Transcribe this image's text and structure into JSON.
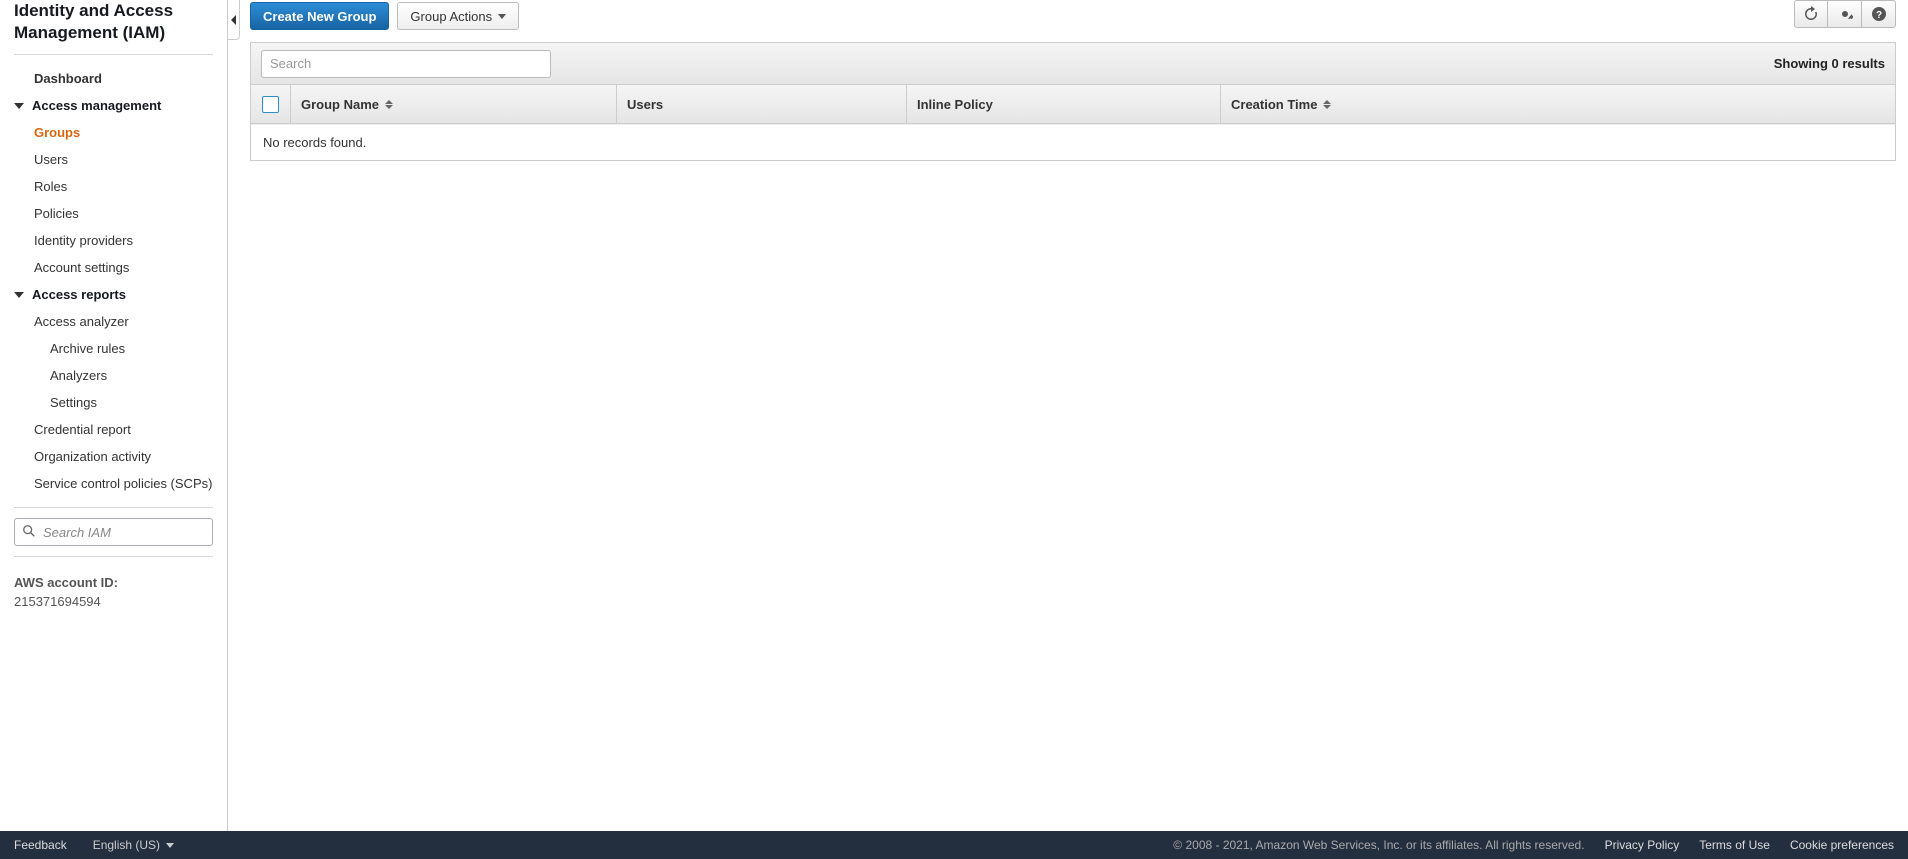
{
  "sidebar": {
    "title": "Identity and Access Management (IAM)",
    "dashboard": "Dashboard",
    "access_management": {
      "label": "Access management",
      "items": [
        {
          "label": "Groups",
          "active": true
        },
        {
          "label": "Users"
        },
        {
          "label": "Roles"
        },
        {
          "label": "Policies"
        },
        {
          "label": "Identity providers"
        },
        {
          "label": "Account settings"
        }
      ]
    },
    "access_reports": {
      "label": "Access reports",
      "analyzer": "Access analyzer",
      "analyzer_children": [
        {
          "label": "Archive rules"
        },
        {
          "label": "Analyzers"
        },
        {
          "label": "Settings"
        }
      ],
      "items": [
        {
          "label": "Credential report"
        },
        {
          "label": "Organization activity"
        },
        {
          "label": "Service control policies (SCPs)"
        }
      ]
    },
    "search_placeholder": "Search IAM",
    "account_id_label": "AWS account ID:",
    "account_id_value": "215371694594"
  },
  "toolbar": {
    "create_btn": "Create New Group",
    "actions_btn": "Group Actions"
  },
  "filter": {
    "search_placeholder": "Search",
    "results_text": "Showing 0 results"
  },
  "table": {
    "columns": {
      "name": "Group Name",
      "users": "Users",
      "inline": "Inline Policy",
      "time": "Creation Time"
    },
    "empty": "No records found."
  },
  "footer": {
    "feedback": "Feedback",
    "language": "English (US)",
    "copyright": "© 2008 - 2021, Amazon Web Services, Inc. or its affiliates. All rights reserved.",
    "privacy": "Privacy Policy",
    "terms": "Terms of Use",
    "cookies": "Cookie preferences"
  }
}
